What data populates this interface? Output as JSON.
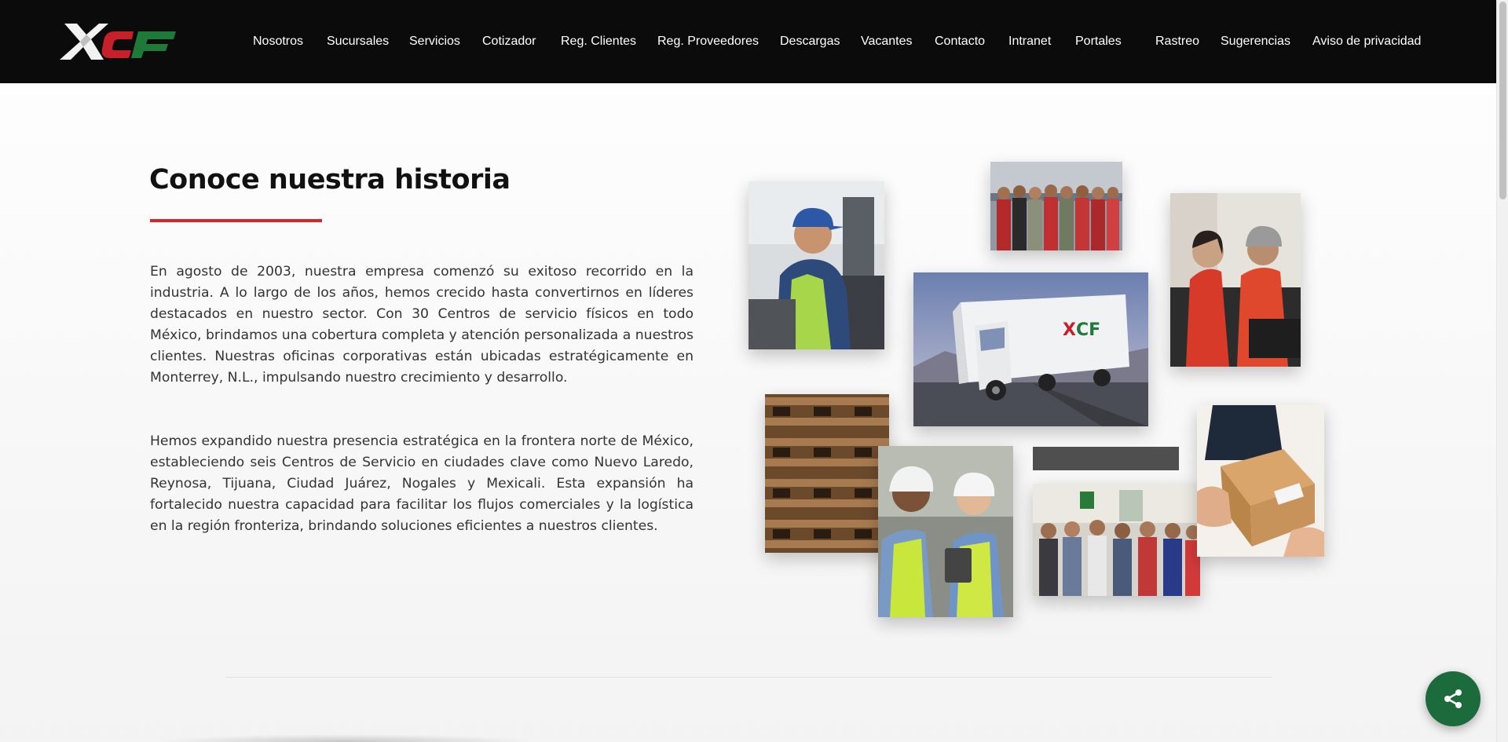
{
  "brand": {
    "logo_text": "XCF",
    "colors": {
      "accent_red": "#d7262b",
      "accent_green": "#1f7a3a",
      "header_bg": "#0b0b0b",
      "share_green": "#1b6b3d"
    }
  },
  "nav": {
    "items": [
      "Nosotros",
      "Sucursales",
      "Servicios",
      "Cotizador",
      "Reg. Clientes",
      "Reg. Proveedores",
      "Descargas",
      "Vacantes",
      "Contacto",
      "Intranet",
      "Portales",
      "Rastreo",
      "Sugerencias",
      "Aviso de privacidad"
    ]
  },
  "history": {
    "title": "Conoce nuestra historia",
    "paragraphs": [
      "En agosto de 2003, nuestra empresa comenzó su exitoso recorrido en la industria. A lo largo de los años, hemos crecido hasta convertirnos en líderes destacados en nuestro sector. Con 30 Centros de servicio físicos en todo México, brindamos una cobertura completa y atención personalizada a nuestros clientes. Nuestras oficinas corporativas están ubicadas estratégicamente en Monterrey, N.L., impulsando nuestro crecimiento y desarrollo.",
      "Hemos expandido nuestra presencia estratégica en la frontera norte de México, estableciendo seis Centros de Servicio en ciudades clave como Nuevo Laredo, Reynosa, Tijuana, Ciudad Juárez, Nogales y Mexicali. Esta expansión ha fortalecido nuestra capacidad para facilitar los flujos comerciales y la logística en la región fronteriza, brindando soluciones eficientes a nuestros clientes."
    ]
  },
  "collage": {
    "photos": [
      "forklift-operator-photo",
      "team-group-photo",
      "warehouse-workers-photo",
      "truck-highway-photo",
      "wooden-pallets-photo",
      "engineers-hardhats-photo",
      "delivery-package-photo",
      "meeting-room-photo"
    ]
  },
  "share": {
    "icon": "share-icon"
  }
}
